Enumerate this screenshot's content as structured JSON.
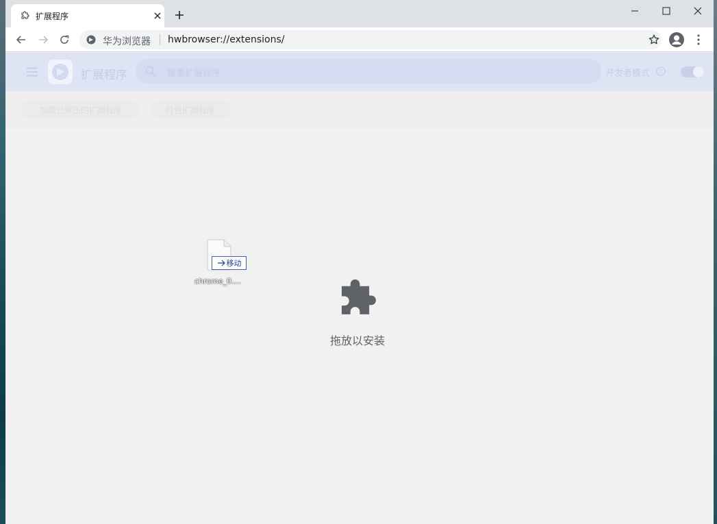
{
  "tab": {
    "title": "扩展程序",
    "icon": "puzzle-icon"
  },
  "window_controls": [
    "minimize-icon",
    "maximize-icon",
    "close-icon"
  ],
  "toolbar": {
    "site_name": "华为浏览器",
    "url": "hwbrowser://extensions/"
  },
  "extensions_header": {
    "title": "扩展程序",
    "search_placeholder": "搜索扩展程序",
    "developer_mode_label": "开发者模式",
    "developer_mode_on": true
  },
  "actions": {
    "load_unpacked": "加载已解压的扩展程序",
    "pack_extension": "打包扩展程序"
  },
  "drop_zone": {
    "label": "拖放以安装"
  },
  "drag": {
    "file_name": "chrome_0....",
    "badge_label": "移动"
  },
  "colors": {
    "header_overlay": "#dfe4f5",
    "accent": "#3c5cae",
    "puzzle": "#5f6368"
  }
}
